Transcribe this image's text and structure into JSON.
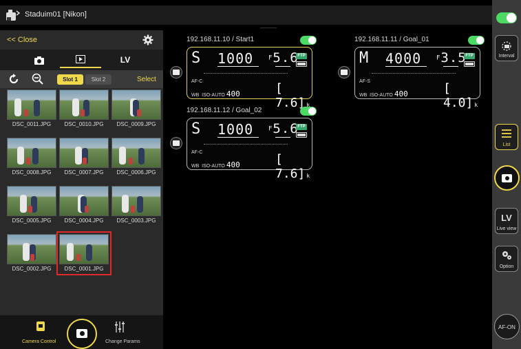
{
  "app": {
    "title": "Staduim01 [Nikon]"
  },
  "left_panel": {
    "close_label": "<< Close",
    "mode_tabs": {
      "photo": "camera-icon",
      "play": "playback-icon",
      "lv_label": "LV"
    },
    "toolbar": {
      "slot1": "Slot 1",
      "slot2": "Slot 2",
      "select": "Select"
    },
    "thumbnails": [
      {
        "name": "DSC_0011.JPG"
      },
      {
        "name": "DSC_0010.JPG"
      },
      {
        "name": "DSC_0009.JPG"
      },
      {
        "name": "DSC_0008.JPG"
      },
      {
        "name": "DSC_0007.JPG"
      },
      {
        "name": "DSC_0006.JPG"
      },
      {
        "name": "DSC_0005.JPG"
      },
      {
        "name": "DSC_0004.JPG"
      },
      {
        "name": "DSC_0003.JPG"
      },
      {
        "name": "DSC_0002.JPG"
      },
      {
        "name": "DSC_0001.JPG",
        "selected": true
      }
    ],
    "bottom": {
      "camera_control": "Camera Control",
      "change_params": "Change Params"
    }
  },
  "cameras": [
    {
      "title": "192.168.11.10 / Start1",
      "mode": "S",
      "shutter": "1000",
      "fnum": "5.6",
      "af": "AF-C",
      "iso_label": "ISO-AUTO",
      "iso": "400",
      "count": "7.6",
      "active": true
    },
    {
      "title": "192.168.11.11 / Goal_01",
      "mode": "M",
      "shutter": "4000",
      "fnum": "3.5",
      "af": "AF-S",
      "iso_label": "ISO-AUTO",
      "iso": "400",
      "count": "4.0",
      "active": false
    },
    {
      "title": "192.168.11.12 / Goal_02",
      "mode": "S",
      "shutter": "1000",
      "fnum": "5.6",
      "af": "AF-C",
      "iso_label": "ISO-AUTO",
      "iso": "400",
      "count": "7.6",
      "active": false
    }
  ],
  "lcd_static": {
    "ftp": "FTP",
    "wb": "WB",
    "k": "k",
    "f_prefix": "F"
  },
  "right_rail": {
    "interval": "Interval",
    "list": "List",
    "lv": "LV",
    "live_view": "Live view",
    "option": "Option",
    "afon": "AF-ON"
  },
  "colors": {
    "accent": "#f0d84b",
    "toggle_on": "#4cd964",
    "selected_outline": "#e02a2a"
  }
}
